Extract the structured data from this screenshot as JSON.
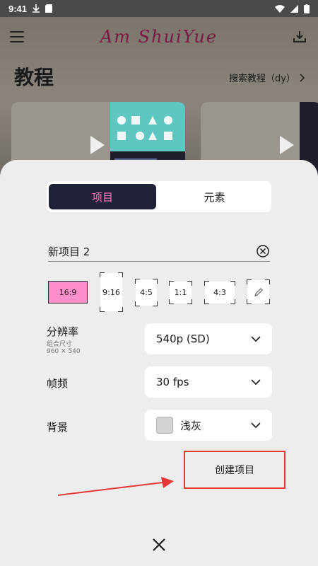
{
  "status_bar": {
    "time": "9:41"
  },
  "header": {
    "app_title": "Am ShuiYue"
  },
  "tutorials": {
    "title": "教程",
    "search_link": "搜索教程（dy）"
  },
  "sheet": {
    "tabs": [
      {
        "label": "项目",
        "active": true
      },
      {
        "label": "元素",
        "active": false
      }
    ],
    "project_name": "新项目 2",
    "ratios": [
      {
        "label": "16:9",
        "selected": true
      },
      {
        "label": "9:16",
        "selected": false
      },
      {
        "label": "4:5",
        "selected": false
      },
      {
        "label": "1:1",
        "selected": false
      },
      {
        "label": "4:3",
        "selected": false
      },
      {
        "label": "",
        "icon": "edit-pencil-icon",
        "selected": false
      }
    ],
    "resolution": {
      "label": "分辨率",
      "sub_label": "组合尺寸",
      "sub_value": "960 ✕ 540",
      "value": "540p (SD)"
    },
    "framerate": {
      "label": "帧频",
      "value": "30 fps"
    },
    "background": {
      "label": "背景",
      "value": "浅灰",
      "swatch_color": "#d4d4d4"
    },
    "create_button": "创建项目"
  },
  "colors": {
    "accent_pink": "#ff79b6",
    "selected_ratio": "#ff8fcb",
    "segment_dark": "#1f2238",
    "highlight_red": "#e53935"
  }
}
